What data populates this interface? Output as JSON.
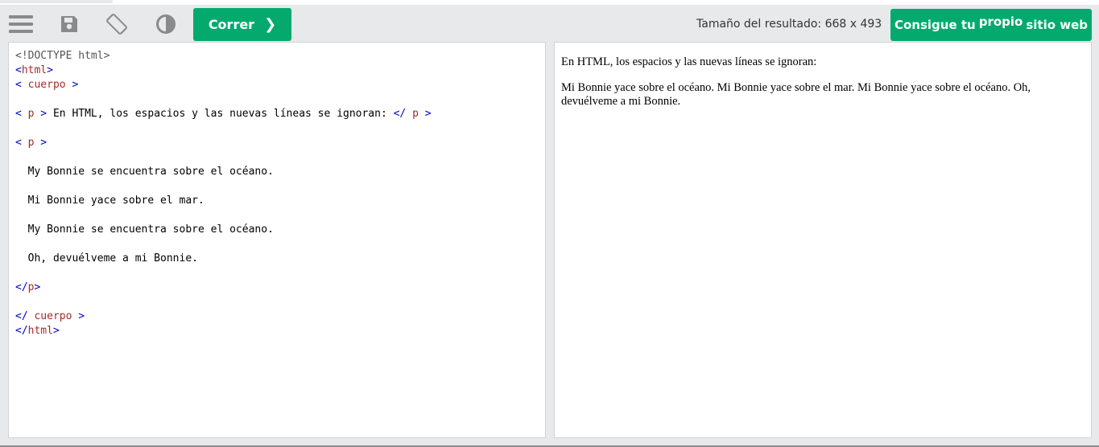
{
  "toolbar": {
    "run_label": "Correr",
    "run_chevron": "❯",
    "result_size": "Tamaño del resultado: 668 x 493",
    "get_site_pre": "Consigue tu",
    "get_site_sup": "propio",
    "get_site_post": "sitio web",
    "accent_color": "#04aa6d",
    "icons": [
      "menu-icon",
      "save-icon",
      "rotate-icon",
      "contrast-icon"
    ]
  },
  "editor": {
    "lines": [
      {
        "parts": [
          {
            "cls": "c-doctype",
            "t": "<!DOCTYPE html>"
          }
        ]
      },
      {
        "parts": [
          {
            "cls": "c-tag",
            "t": "<"
          },
          {
            "cls": "c-name",
            "t": "html"
          },
          {
            "cls": "c-tag",
            "t": ">"
          }
        ]
      },
      {
        "parts": [
          {
            "cls": "c-tag",
            "t": "< "
          },
          {
            "cls": "c-name",
            "t": "cuerpo"
          },
          {
            "cls": "c-tag",
            "t": " >"
          }
        ]
      },
      {
        "parts": []
      },
      {
        "parts": [
          {
            "cls": "c-tag",
            "t": "< "
          },
          {
            "cls": "c-name",
            "t": "p"
          },
          {
            "cls": "c-tag",
            "t": " >"
          },
          {
            "cls": "c-text",
            "t": " En HTML, los espacios y las nuevas líneas se ignoran: "
          },
          {
            "cls": "c-tag",
            "t": "</ "
          },
          {
            "cls": "c-name",
            "t": "p"
          },
          {
            "cls": "c-tag",
            "t": " >"
          }
        ]
      },
      {
        "parts": []
      },
      {
        "parts": [
          {
            "cls": "c-tag",
            "t": "< "
          },
          {
            "cls": "c-name",
            "t": "p"
          },
          {
            "cls": "c-tag",
            "t": " >"
          }
        ]
      },
      {
        "parts": []
      },
      {
        "parts": [
          {
            "cls": "c-text",
            "t": "  My Bonnie se encuentra sobre el océano."
          }
        ]
      },
      {
        "parts": []
      },
      {
        "parts": [
          {
            "cls": "c-text",
            "t": "  Mi Bonnie yace sobre el mar."
          }
        ]
      },
      {
        "parts": []
      },
      {
        "parts": [
          {
            "cls": "c-text",
            "t": "  My Bonnie se encuentra sobre el océano."
          }
        ]
      },
      {
        "parts": []
      },
      {
        "parts": [
          {
            "cls": "c-text",
            "t": "  Oh, devuélveme a mi Bonnie."
          }
        ]
      },
      {
        "parts": []
      },
      {
        "parts": [
          {
            "cls": "c-tag",
            "t": "</"
          },
          {
            "cls": "c-name",
            "t": "p"
          },
          {
            "cls": "c-tag",
            "t": ">"
          }
        ]
      },
      {
        "parts": []
      },
      {
        "parts": [
          {
            "cls": "c-tag",
            "t": "</ "
          },
          {
            "cls": "c-name",
            "t": "cuerpo"
          },
          {
            "cls": "c-tag",
            "t": " >"
          }
        ]
      },
      {
        "parts": [
          {
            "cls": "c-tag",
            "t": "</"
          },
          {
            "cls": "c-name",
            "t": "html"
          },
          {
            "cls": "c-tag",
            "t": ">"
          }
        ]
      }
    ]
  },
  "result": {
    "p1": "En HTML, los espacios y las nuevas líneas se ignoran:",
    "p2": "Mi Bonnie yace sobre el océano. Mi Bonnie yace sobre el mar. Mi Bonnie yace sobre el océano. Oh, devuélveme a mi Bonnie."
  }
}
